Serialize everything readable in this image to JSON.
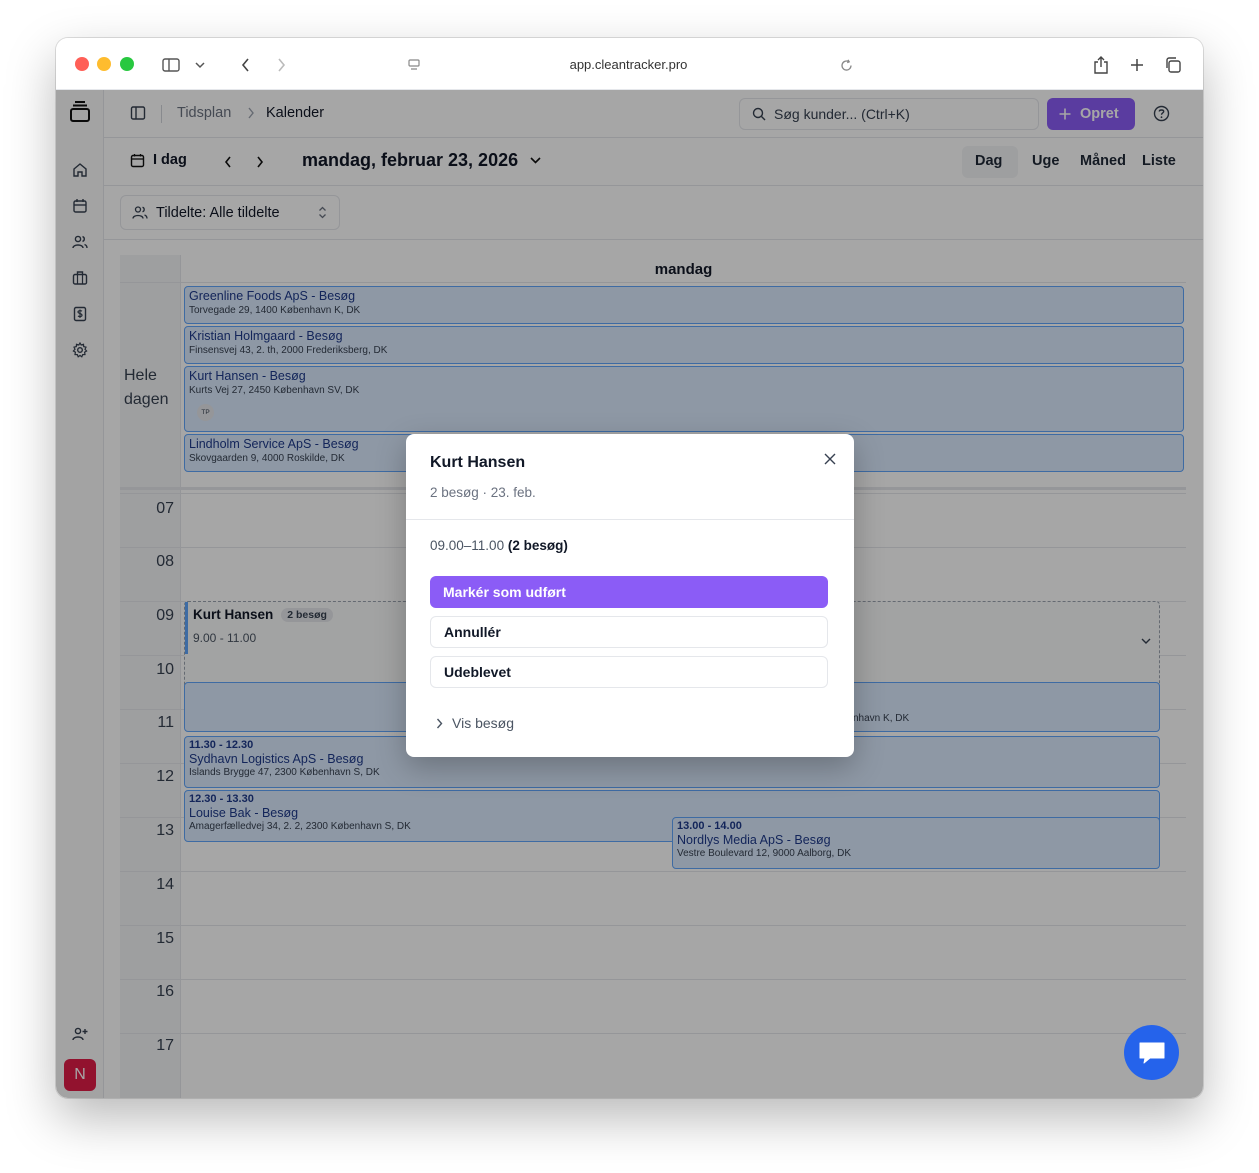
{
  "browser": {
    "url": "app.cleantracker.pro"
  },
  "topbar": {
    "breadcrumb_parent": "Tidsplan",
    "breadcrumb_current": "Kalender",
    "search_placeholder": "Søg kunder... (Ctrl+K)",
    "create_label": "Opret"
  },
  "toolbar": {
    "today_label": "I dag",
    "date_title": "mandag, februar 23, 2026",
    "views": [
      "Dag",
      "Uge",
      "Måned",
      "Liste"
    ],
    "active_view": "Dag"
  },
  "filter": {
    "assigned_label": "Tildelte: Alle tildelte"
  },
  "calendar": {
    "day_header": "mandag",
    "allday_label_1": "Hele",
    "allday_label_2": "dagen",
    "allday_events": [
      {
        "title": "Greenline Foods ApS - Besøg",
        "address": "Torvegade 29, 1400 København K, DK"
      },
      {
        "title": "Kristian Holmgaard - Besøg",
        "address": "Finsensvej 43, 2. th, 2000 Frederiksberg, DK"
      },
      {
        "title": "Kurt Hansen - Besøg",
        "address": "Kurts Vej 27, 2450 København SV, DK",
        "badge": "TP"
      },
      {
        "title": "Lindholm Service ApS - Besøg",
        "address": "Skovgaarden 9, 4000 Roskilde, DK"
      }
    ],
    "hours": [
      "07",
      "08",
      "09",
      "10",
      "11",
      "12",
      "13",
      "14",
      "15",
      "16",
      "17"
    ],
    "group_event": {
      "name": "Kurt Hansen",
      "badge": "2 besøg",
      "time": "9.00 - 11.00"
    },
    "partial_event_address": "nhavn K, DK",
    "events": [
      {
        "time": "11.30 - 12.30",
        "title": "Sydhavn Logistics ApS - Besøg",
        "address": "Islands Brygge 47, 2300 København S, DK"
      },
      {
        "time": "12.30 - 13.30",
        "title": "Louise Bak - Besøg",
        "address": "Amagerfælledvej 34, 2. 2, 2300 København S, DK"
      },
      {
        "time": "13.00 - 14.00",
        "title": "Nordlys Media ApS - Besøg",
        "address": "Vestre Boulevard 12, 9000 Aalborg, DK"
      }
    ]
  },
  "modal": {
    "title": "Kurt Hansen",
    "subtitle": "2 besøg · 23. feb.",
    "time_range": "09.00–11.00",
    "count": "(2 besøg)",
    "mark_done": "Markér som udført",
    "cancel": "Annullér",
    "no_show": "Udeblevet",
    "show_visits": "Vis besøg"
  },
  "sidebar": {
    "avatar_initial": "N"
  },
  "colors": {
    "accent": "#8b5cf6",
    "event_bg": "#dbeafe",
    "event_border": "#60a5fa",
    "chat": "#2563eb",
    "avatar": "#e11d48"
  }
}
